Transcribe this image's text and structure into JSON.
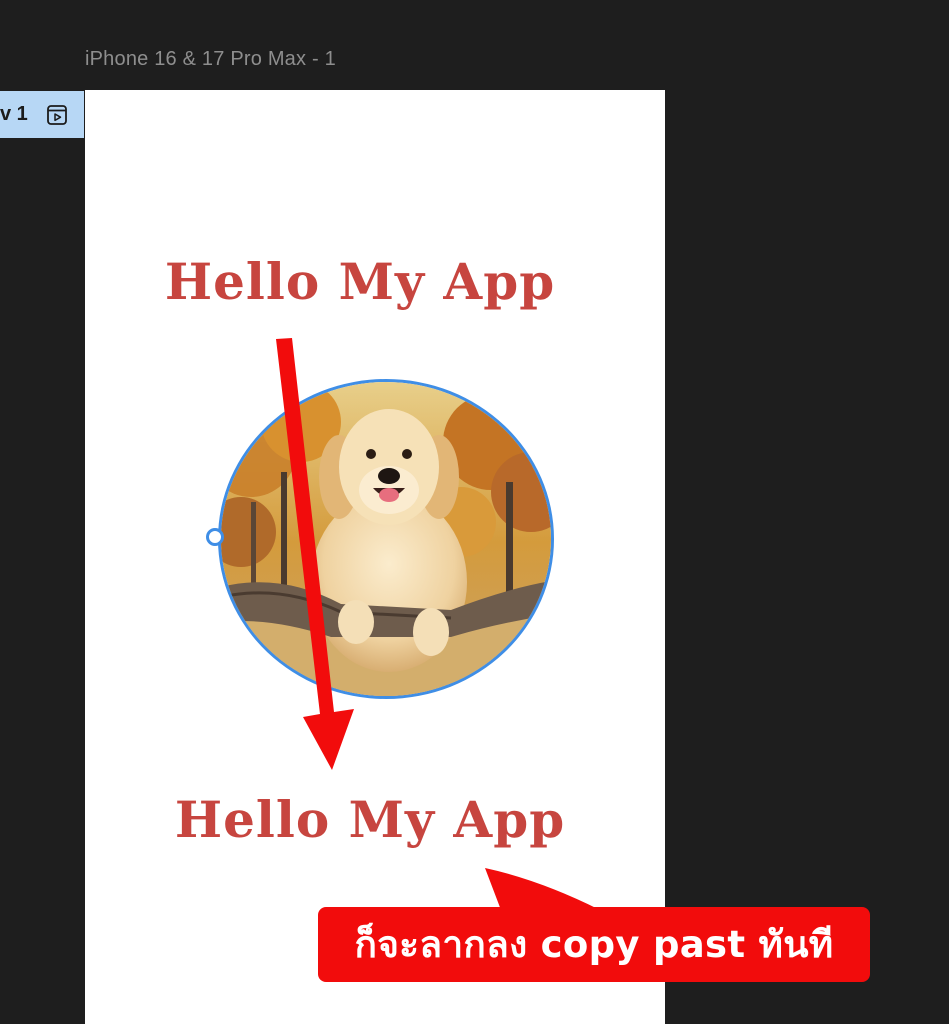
{
  "canvas": {
    "frame_label": "iPhone 16 & 17 Pro Max - 1",
    "flow_tab_label": "v 1",
    "background_color": "#1e1e1e"
  },
  "phone": {
    "title_top": "Hello My App",
    "title_bottom": "Hello My App",
    "title_color": "#c7453f",
    "image_subject": "golden retriever dog leaning on a log, autumn trees behind",
    "selection_color": "#3f8ee6"
  },
  "annotation": {
    "callout_text": "ก็จะลากลง copy past ทันที",
    "arrow_color": "#f20c0c"
  },
  "icons": {
    "flow_play": "play-frame-icon"
  }
}
